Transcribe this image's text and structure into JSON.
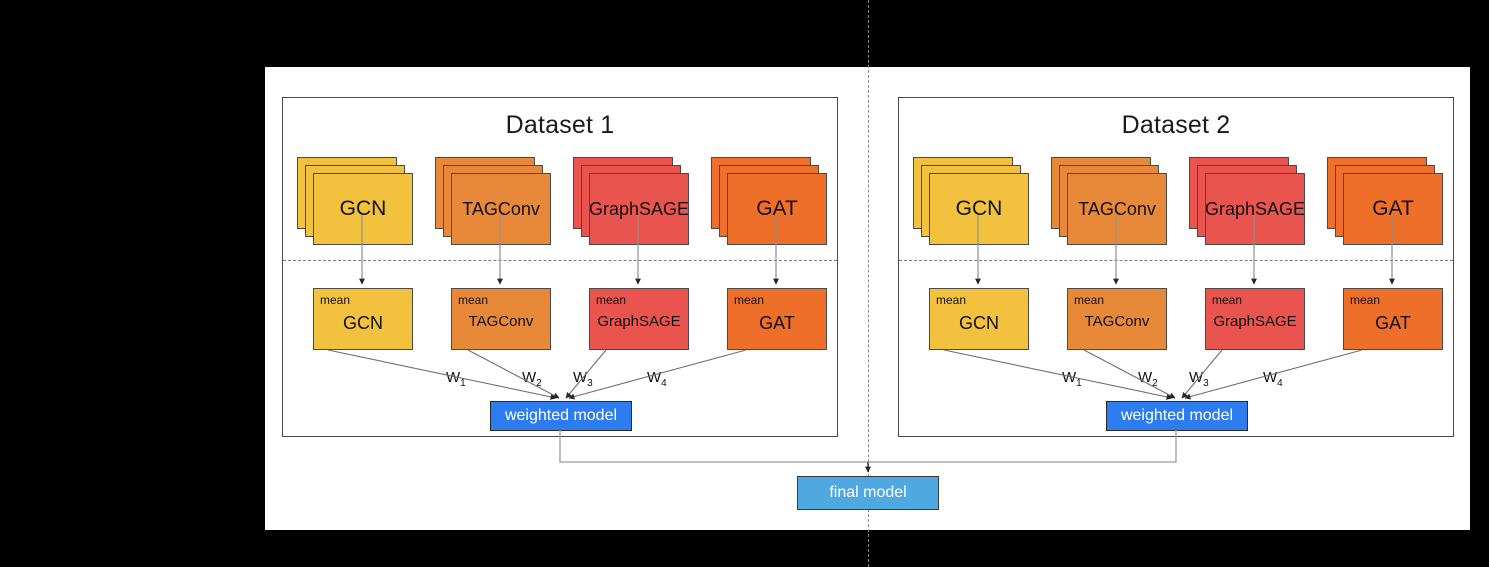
{
  "diagram": {
    "title_hidden": "",
    "colors": {
      "gcn": "#F2C23E",
      "tagconv": "#E8893A",
      "graphsage": "#E9544E",
      "gat": "#ED6F2A",
      "weighted_model": "#2D7DF0",
      "final_model": "#4FA9E0",
      "border": "#4a4a4a",
      "canvas": "#ffffff",
      "page": "#000000"
    },
    "panels": [
      {
        "id": "dataset-1",
        "title": "Dataset 1",
        "models": [
          {
            "key": "gcn",
            "label": "GCN",
            "mean_tag": "mean",
            "mean_label": "GCN",
            "color": "#F2C23E",
            "long": false
          },
          {
            "key": "tagconv",
            "label": "TAGConv",
            "mean_tag": "mean",
            "mean_label": "TAGConv",
            "color": "#E8893A",
            "long": false
          },
          {
            "key": "graphsage",
            "label": "GraphSAGE",
            "mean_tag": "mean",
            "mean_label": "GraphSAGE",
            "color": "#E9544E",
            "long": true
          },
          {
            "key": "gat",
            "label": "GAT",
            "mean_tag": "mean",
            "mean_label": "GAT",
            "color": "#ED6F2A",
            "long": false
          }
        ],
        "weights": [
          "W",
          "W",
          "W",
          "W"
        ],
        "weight_subs": [
          "1",
          "2",
          "3",
          "4"
        ],
        "weighted_model_label": "weighted model"
      },
      {
        "id": "dataset-2",
        "title": "Dataset 2",
        "models": [
          {
            "key": "gcn",
            "label": "GCN",
            "mean_tag": "mean",
            "mean_label": "GCN",
            "color": "#F2C23E",
            "long": false
          },
          {
            "key": "tagconv",
            "label": "TAGConv",
            "mean_tag": "mean",
            "mean_label": "TAGConv",
            "color": "#E8893A",
            "long": false
          },
          {
            "key": "graphsage",
            "label": "GraphSAGE",
            "mean_tag": "mean",
            "mean_label": "GraphSAGE",
            "color": "#E9544E",
            "long": true
          },
          {
            "key": "gat",
            "label": "GAT",
            "mean_tag": "mean",
            "mean_label": "GAT",
            "color": "#ED6F2A",
            "long": false
          }
        ],
        "weights": [
          "W",
          "W",
          "W",
          "W"
        ],
        "weight_subs": [
          "1",
          "2",
          "3",
          "4"
        ],
        "weighted_model_label": "weighted model"
      }
    ],
    "final_model_label": "final model"
  }
}
